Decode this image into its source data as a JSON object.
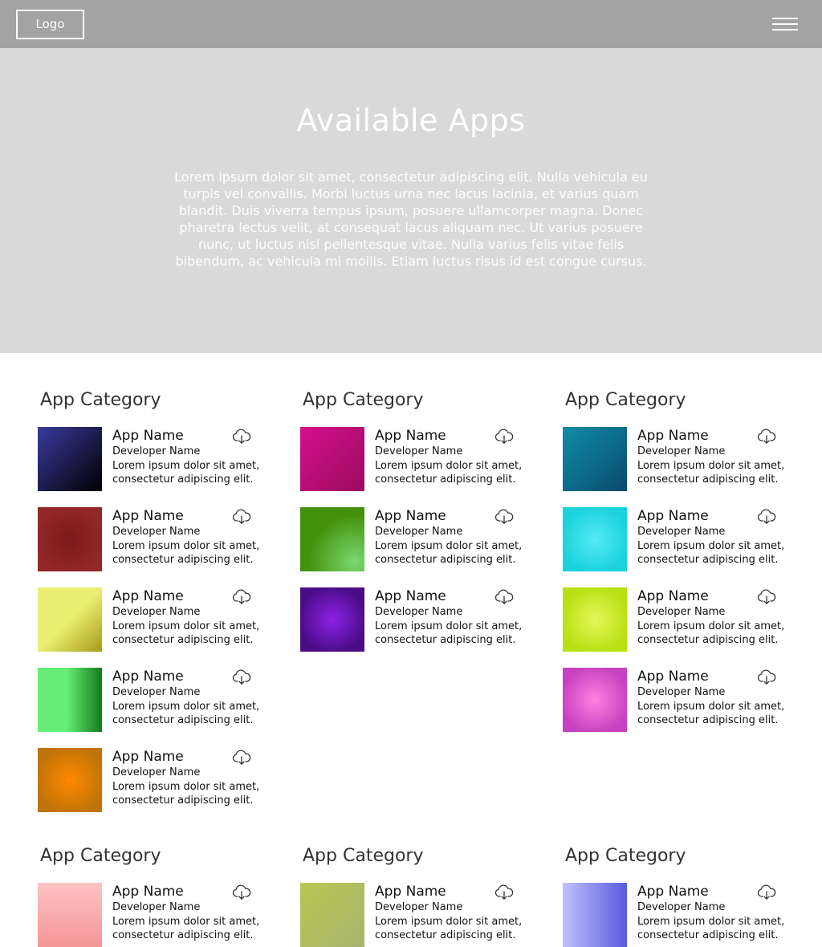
{
  "header": {
    "logo": "Logo",
    "menu_icon": "hamburger-menu-icon"
  },
  "hero": {
    "title": "Available Apps",
    "text": "Lorem ipsum dolor sit amet, consectetur adipiscing elit. Nulla vehicula eu turpis vel convallis. Morbi luctus urna nec lacus lacinia, et varius quam blandit. Duis viverra tempus ipsum, posuere ullamcorper magna. Donec pharetra lectus velit, at consequat lacus aliquam nec. Ut varius posuere nunc, ut luctus nisl pellentesque vitae. Nulla varius felis vitae felis bibendum, ac vehicula mi mollis. Etiam luctus risus id est congue cursus."
  },
  "colors": {
    "topbar": "#a3a3a3",
    "hero": "#d9d9d9"
  },
  "categories": [
    {
      "title": "App Category",
      "apps": [
        {
          "name": "App Name",
          "developer": "Developer Name",
          "description": "Lorem ipsum dolor sit amet, consectetur adipiscing elit.",
          "icon_colors": [
            "#3a3aa0",
            "#000000"
          ],
          "icon_style": "linear-diag"
        },
        {
          "name": "App Name",
          "developer": "Developer Name",
          "description": "Lorem ipsum dolor sit amet, consectetur adipiscing elit.",
          "icon_colors": [
            "#7a1a1a",
            "#922828"
          ],
          "icon_style": "radial"
        },
        {
          "name": "App Name",
          "developer": "Developer Name",
          "description": "Lorem ipsum dolor sit amet, consectetur adipiscing elit.",
          "icon_colors": [
            "#e8ee70",
            "#a89a14"
          ],
          "icon_style": "linear-diag-split"
        },
        {
          "name": "App Name",
          "developer": "Developer Name",
          "description": "Lorem ipsum dolor sit amet, consectetur adipiscing elit.",
          "icon_colors": [
            "#66ee77",
            "#137a1c"
          ],
          "icon_style": "linear-h-split"
        },
        {
          "name": "App Name",
          "developer": "Developer Name",
          "description": "Lorem ipsum dolor sit amet, consectetur adipiscing elit.",
          "icon_colors": [
            "#ff8800",
            "#c07408"
          ],
          "icon_style": "radial"
        }
      ]
    },
    {
      "title": "App Category",
      "apps": [
        {
          "name": "App Name",
          "developer": "Developer Name",
          "description": "Lorem ipsum dolor sit amet, consectetur adipiscing elit.",
          "icon_colors": [
            "#d4108c",
            "#9a0a5e"
          ],
          "icon_style": "linear-diag"
        },
        {
          "name": "App Name",
          "developer": "Developer Name",
          "description": "Lorem ipsum dolor sit amet, consectetur adipiscing elit.",
          "icon_colors": [
            "#44920c",
            "#7ad870"
          ],
          "icon_style": "corner-glow"
        },
        {
          "name": "App Name",
          "developer": "Developer Name",
          "description": "Lorem ipsum dolor sit amet, consectetur adipiscing elit.",
          "icon_colors": [
            "#8c22e6",
            "#4a0c86"
          ],
          "icon_style": "radial"
        }
      ]
    },
    {
      "title": "App Category",
      "apps": [
        {
          "name": "App Name",
          "developer": "Developer Name",
          "description": "Lorem ipsum dolor sit amet, consectetur adipiscing elit.",
          "icon_colors": [
            "#118ca8",
            "#0a4a6e"
          ],
          "icon_style": "linear-diag"
        },
        {
          "name": "App Name",
          "developer": "Developer Name",
          "description": "Lorem ipsum dolor sit amet, consectetur adipiscing elit.",
          "icon_colors": [
            "#55eaf4",
            "#1ad2dc"
          ],
          "icon_style": "radial"
        },
        {
          "name": "App Name",
          "developer": "Developer Name",
          "description": "Lorem ipsum dolor sit amet, consectetur adipiscing elit.",
          "icon_colors": [
            "#e4f65a",
            "#b8e012"
          ],
          "icon_style": "radial"
        },
        {
          "name": "App Name",
          "developer": "Developer Name",
          "description": "Lorem ipsum dolor sit amet, consectetur adipiscing elit.",
          "icon_colors": [
            "#ff80e0",
            "#c642c0"
          ],
          "icon_style": "radial"
        }
      ]
    },
    {
      "title": "App Category",
      "apps": [
        {
          "name": "App Name",
          "developer": "Developer Name",
          "description": "Lorem ipsum dolor sit amet, consectetur adipiscing elit.",
          "icon_colors": [
            "#ffc2c2",
            "#f49696"
          ],
          "icon_style": "linear-v"
        }
      ]
    },
    {
      "title": "App Category",
      "apps": [
        {
          "name": "App Name",
          "developer": "Developer Name",
          "description": "Lorem ipsum dolor sit amet, consectetur adipiscing elit.",
          "icon_colors": [
            "#b8c650",
            "#a8b470"
          ],
          "icon_style": "linear-diag"
        }
      ]
    },
    {
      "title": "App Category",
      "apps": [
        {
          "name": "App Name",
          "developer": "Developer Name",
          "description": "Lorem ipsum dolor sit amet, consectetur adipiscing elit.",
          "icon_colors": [
            "#c0c0ff",
            "#5a5ae0"
          ],
          "icon_style": "linear-h"
        }
      ]
    }
  ]
}
